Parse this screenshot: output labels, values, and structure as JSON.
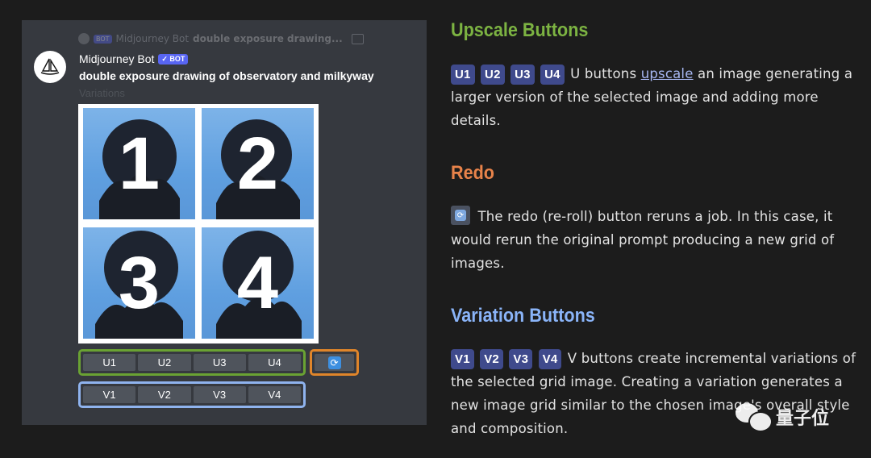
{
  "discord": {
    "reply_preview": {
      "bot_badge": "BOT",
      "author": "Midjourney Bot",
      "text": "double exposure drawing..."
    },
    "author_name": "Midjourney Bot",
    "bot_badge": "✓ BOT",
    "prompt": "double exposure drawing of observatory and milkyway",
    "variations_label": "Variations",
    "tiles": [
      "1",
      "2",
      "3",
      "4"
    ],
    "upscale_buttons": [
      "U1",
      "U2",
      "U3",
      "U4"
    ],
    "variation_buttons": [
      "V1",
      "V2",
      "V3",
      "V4"
    ],
    "redo_icon": "refresh-icon"
  },
  "docs": {
    "upscale": {
      "title": "Upscale Buttons",
      "chips": [
        "U1",
        "U2",
        "U3",
        "U4"
      ],
      "text_before_link": " U buttons ",
      "link": "upscale",
      "text_after_link": " an image generating a larger version of the selected image and adding more details."
    },
    "redo": {
      "title": "Redo",
      "text": " The redo (re-roll) button reruns a job. In this case, it would rerun the original prompt producing a new grid of images."
    },
    "variation": {
      "title": "Variation Buttons",
      "chips": [
        "V1",
        "V2",
        "V3",
        "V4"
      ],
      "text": " V buttons create incremental variations of the selected grid image. Creating a variation generates a new image grid similar to the chosen image's overall style and composition."
    }
  },
  "watermark": {
    "text": "量子位"
  },
  "colors": {
    "upscale_accent": "#7cb342",
    "redo_accent": "#e8834a",
    "variation_accent": "#8ab4f8",
    "chip_bg": "#3f4a8c",
    "discord_bg": "#36393f",
    "page_bg": "#1c1c1c"
  }
}
